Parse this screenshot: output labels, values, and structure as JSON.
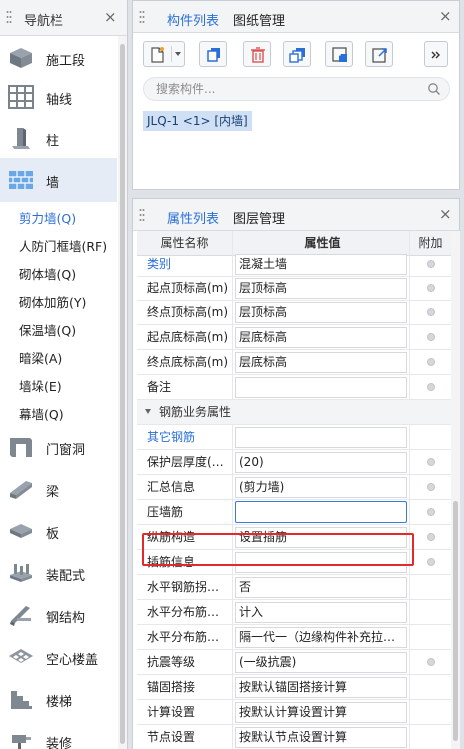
{
  "nav": {
    "title": "导航栏",
    "close": "×",
    "categories": {
      "construction_stage": "施工段",
      "axis": "轴线",
      "column": "柱",
      "wall": "墙",
      "door_window": "门窗洞",
      "beam": "梁",
      "slab": "板",
      "prefab": "装配式",
      "steel": "钢结构",
      "hollow_floor": "空心楼盖",
      "stairs": "楼梯",
      "decoration": "装修"
    },
    "wall_items": [
      "剪力墙(Q)",
      "人防门框墙(RF)",
      "砌体墙(Q)",
      "砌体加筋(Y)",
      "保温墙(Q)",
      "暗梁(A)",
      "墙垛(E)",
      "幕墙(Q)"
    ]
  },
  "component_panel": {
    "tabs": [
      "构件列表",
      "图纸管理"
    ],
    "close": "×",
    "search_placeholder": "搜索构件...",
    "member": "JLQ-1 <1> [内墙]"
  },
  "property_panel": {
    "tabs": [
      "属性列表",
      "图层管理"
    ],
    "close": "×",
    "headers": [
      "属性名称",
      "属性值",
      "附加"
    ],
    "group_label": "钢筋业务属性",
    "rows": [
      {
        "name": "类别",
        "value": "混凝土墙"
      },
      {
        "name": "起点顶标高(m)",
        "value": "层顶标高"
      },
      {
        "name": "终点顶标高(m)",
        "value": "层顶标高"
      },
      {
        "name": "起点底标高(m)",
        "value": "层底标高"
      },
      {
        "name": "终点底标高(m)",
        "value": "层底标高"
      },
      {
        "name": "备注",
        "value": ""
      }
    ],
    "rebar_rows": [
      {
        "name": "其它钢筋",
        "value": ""
      },
      {
        "name": "保护层厚度(…",
        "value": "(20)"
      },
      {
        "name": "汇总信息",
        "value": "(剪力墙)"
      },
      {
        "name": "压墙筋",
        "value": ""
      },
      {
        "name": "纵筋构造",
        "value": "设置插筋"
      },
      {
        "name": "插筋信息",
        "value": ""
      },
      {
        "name": "水平钢筋拐…",
        "value": "否"
      },
      {
        "name": "水平分布筋…",
        "value": "计入"
      },
      {
        "name": "水平分布筋…",
        "value": "隔一代一（边缘构件补充拉…"
      },
      {
        "name": "抗震等级",
        "value": "(一级抗震)"
      },
      {
        "name": "锚固搭接",
        "value": "按默认锚固搭接计算"
      },
      {
        "name": "计算设置",
        "value": "按默认计算设置计算"
      },
      {
        "name": "节点设置",
        "value": "按默认节点设置计算"
      }
    ]
  },
  "colors": {
    "accent": "#2a6fd8",
    "highlight": "#e02b2b",
    "selected_bg": "#e5ecf6"
  }
}
